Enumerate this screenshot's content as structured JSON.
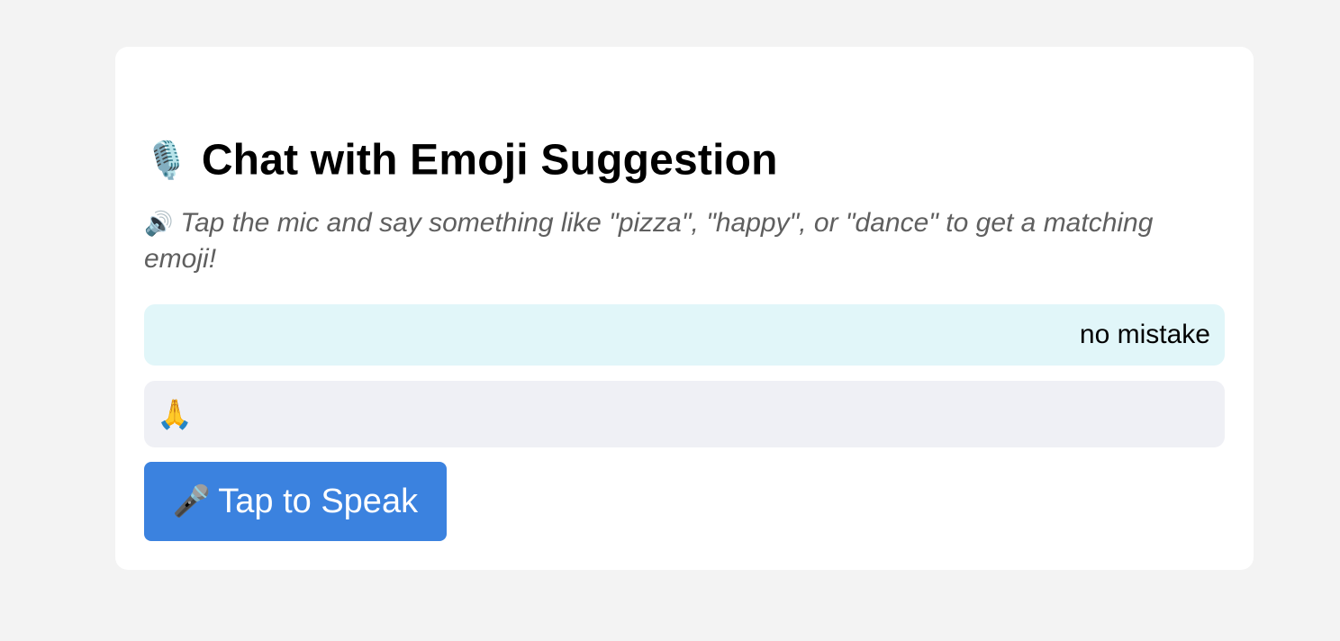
{
  "header": {
    "icon": "🎙️",
    "icon_name": "studio-microphone-icon",
    "title": "Chat with Emoji Suggestion"
  },
  "instructions": {
    "icon": "🔊",
    "icon_name": "speaker-icon",
    "text": "Tap the mic and say something like \"pizza\", \"happy\", or \"dance\" to get a matching emoji!"
  },
  "chat": {
    "messages": [
      {
        "role": "user",
        "text": "no mistake"
      },
      {
        "role": "bot",
        "text": "🙏"
      }
    ]
  },
  "speak_button": {
    "icon": "🎤",
    "icon_name": "microphone-icon",
    "label": "Tap to Speak",
    "color": "#3b82df"
  },
  "colors": {
    "page_background": "#f3f3f3",
    "card_background": "#ffffff",
    "user_bubble": "#e1f6f9",
    "bot_bubble": "#eff0f5"
  }
}
